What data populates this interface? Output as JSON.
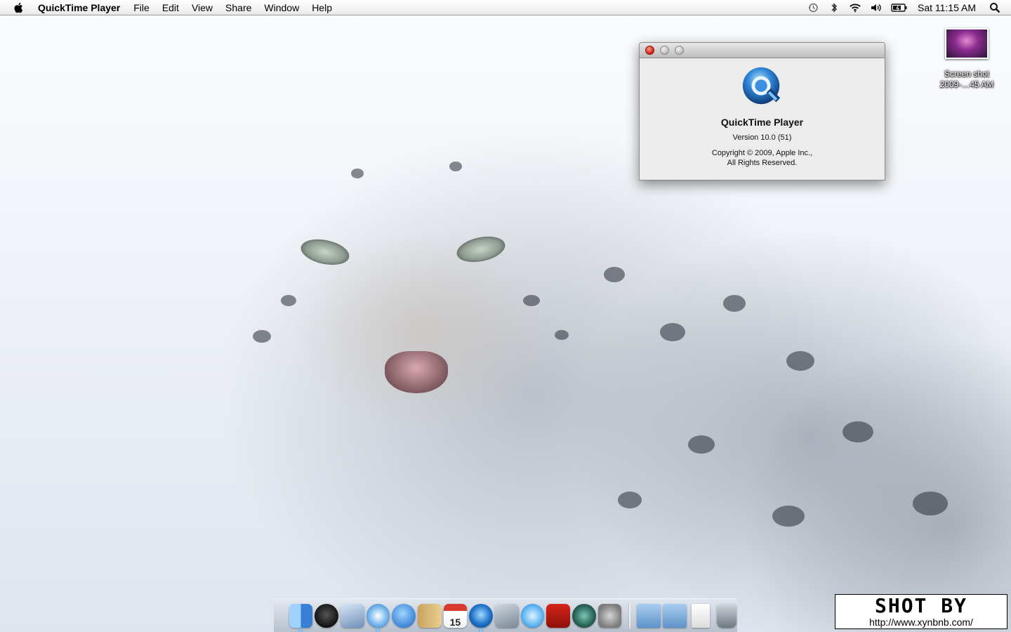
{
  "menubar": {
    "apple_icon": "apple-logo",
    "app_name": "QuickTime Player",
    "menus": [
      "File",
      "Edit",
      "View",
      "Share",
      "Window",
      "Help"
    ],
    "status_icons": [
      "time-machine-icon",
      "bluetooth-icon",
      "wifi-icon",
      "volume-icon",
      "battery-icon"
    ],
    "clock": "Sat 11:15 AM",
    "spotlight_icon": "spotlight-search-icon"
  },
  "about_window": {
    "app_name": "QuickTime Player",
    "version": "Version 10.0 (51)",
    "copyright_line1": "Copyright © 2009, Apple Inc.,",
    "copyright_line2": "All Rights Reserved."
  },
  "desktop_file": {
    "name_line1": "Screen shot",
    "name_line2": "2009-…45 AM"
  },
  "dock": {
    "apps": [
      {
        "name": "finder",
        "running": true
      },
      {
        "name": "dashboard",
        "running": false
      },
      {
        "name": "mail",
        "running": false
      },
      {
        "name": "safari",
        "running": true
      },
      {
        "name": "ichat",
        "running": false
      },
      {
        "name": "address-book",
        "running": false
      },
      {
        "name": "ical",
        "running": false,
        "label": "15"
      },
      {
        "name": "quicktime",
        "running": true
      },
      {
        "name": "iphoto",
        "running": false
      },
      {
        "name": "itunes",
        "running": false
      },
      {
        "name": "photo-booth",
        "running": false
      },
      {
        "name": "time-machine",
        "running": false
      },
      {
        "name": "system-preferences",
        "running": false
      }
    ],
    "stacks": [
      "applications-folder",
      "documents-folder",
      "preview-document",
      "trash"
    ]
  },
  "watermark": {
    "title": "SHOT BY",
    "url": "http://www.xynbnb.com/"
  }
}
